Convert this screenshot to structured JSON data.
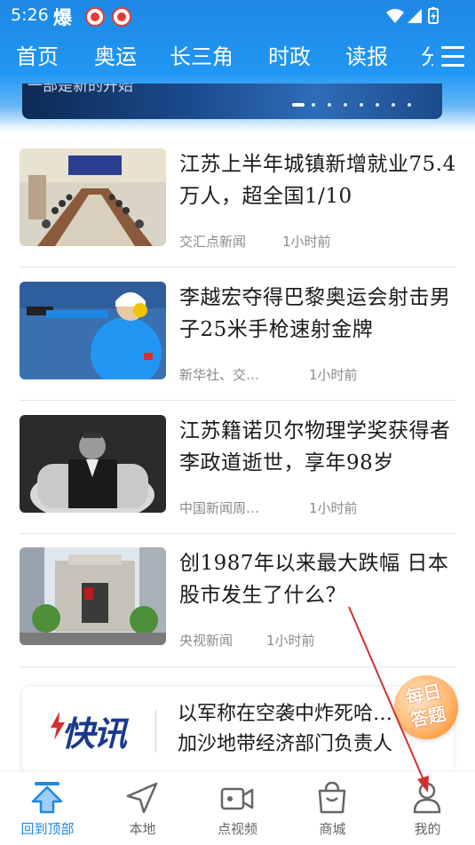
{
  "status_bar": {
    "time": "5:26",
    "bao_char": "爆"
  },
  "nav": {
    "tabs": [
      "首页",
      "奥运",
      "长三角",
      "时政",
      "读报",
      "分"
    ]
  },
  "banner": {
    "caption": "一部是新的开始"
  },
  "news": [
    {
      "title": "江苏上半年城镇新增就业75.4万人，超全国1/10",
      "source": "交汇点新闻",
      "time": "1小时前"
    },
    {
      "title": "李越宏夺得巴黎奥运会射击男子25米手枪速射金牌",
      "source": "新华社、交…",
      "time": "1小时前"
    },
    {
      "title": "江苏籍诺贝尔物理学奖获得者李政道逝世，享年98岁",
      "source": "中国新闻周…",
      "time": "1小时前"
    },
    {
      "title": "创1987年以来最大跌幅 日本股市发生了什么？",
      "source": "央视新闻",
      "time": "1小时前"
    }
  ],
  "flash": {
    "logo": "快讯",
    "text": "以军称在空袭中炸死哈…加沙地带经济部门负责人"
  },
  "quiz_badge": {
    "text": "每日\n答题"
  },
  "tabbar": {
    "tabs": [
      {
        "label": "回到顶部",
        "icon": "back-to-top-icon",
        "active": true
      },
      {
        "label": "本地",
        "icon": "location-arrow-icon",
        "active": false
      },
      {
        "label": "点视频",
        "icon": "video-camera-icon",
        "active": false
      },
      {
        "label": "商城",
        "icon": "shopping-bag-icon",
        "active": false
      },
      {
        "label": "我的",
        "icon": "user-profile-icon",
        "active": false
      }
    ]
  },
  "colors": {
    "brand_blue": "#1e88e5",
    "annotation_red": "#d32f2f"
  }
}
